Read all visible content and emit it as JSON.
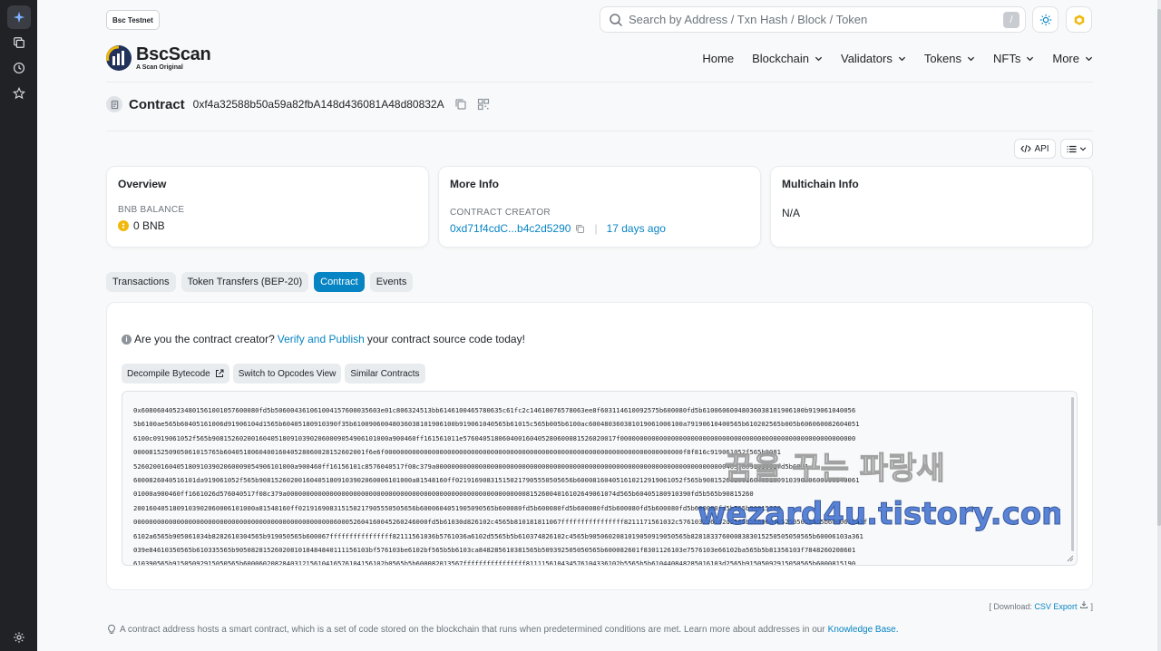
{
  "network_badge": "Bsc Testnet",
  "search": {
    "placeholder": "Search by Address / Txn Hash / Block / Token",
    "shortcut": "/"
  },
  "logo": {
    "brand": "BscScan",
    "tagline": "A Scan Original"
  },
  "nav": [
    "Home",
    "Blockchain",
    "Validators",
    "Tokens",
    "NFTs",
    "More"
  ],
  "contract": {
    "label": "Contract",
    "address": "0xf4a32588b50a59a82fbA148d436081A48d80832A"
  },
  "toolbar": {
    "api_label": "API"
  },
  "overview": {
    "title": "Overview",
    "balance_label": "BNB BALANCE",
    "balance_value": "0 BNB"
  },
  "more_info": {
    "title": "More Info",
    "creator_label": "CONTRACT CREATOR",
    "creator_address": "0xd71f4cdC...b4c2d5290",
    "creator_age": "17 days ago"
  },
  "multichain": {
    "title": "Multichain Info",
    "value": "N/A"
  },
  "tabs": [
    "Transactions",
    "Token Transfers (BEP-20)",
    "Contract",
    "Events"
  ],
  "notice": {
    "prefix": "Are you the contract creator?",
    "link": "Verify and Publish",
    "suffix": "your contract source code today!"
  },
  "actions": [
    "Decompile Bytecode",
    "Switch to Opcodes View",
    "Similar Contracts"
  ],
  "bytecode": "0x608060405234801561001057600080fd5b50600436106100415760003560e01c806324513bb6146100465780635c61fc2c14610076578063ee8f603114610092575b600080fd5b610060600480360381019061005b9190610400565b6100ae565b60405161006d91906104d1565b60405180910390f35b61009060048036038101906100b91906104005656b61015c565b005b6100ac6004803603810190610...",
  "bytecode_lines": [
    "0x608060405234801561001057600080fd5b506004361061004157600035603e01c806324513bb6146100465780635c61fc2c14610076578063ee8f603114610092575b600080fd5b61006060048036038101906100b919061040056",
    "5b6100ae565b60405161006d91906104d1565b60405180910390f35b61009060048036038101906100b919061040565b61015c565b005b6100ac600480360381019061006100a79190610400565b610202565b005b606060082604051",
    "6100c0919061052f565b908152602001604051809103902060009054906101000a900460ff161561011e576040518060400160405280600081526020017f000000000000000000000000000000000000000000000000000000000000",
    "0000815250905061015765b604051806040016040528060028152602001f6e6f0000000000000000000000000000000000000000000000000000000000000000000000000000f8f816c919061052f565b9081",
    "52602001604051809103902060009054906101000a900460ff16156101c8576040517f08c379a000000000000000000000000000000000000000000000000000000000000000000000000004051809103902fd5b6001",
    "600082604051610 1da919061052f565b908152602001604051809103902060006101000a81548160ff021916908315150217905550505656b600081604051610212919061052f565b908152602001604051809103902060009054906 1",
    "01000a900460ff1661026d576040517f08c379a000000000000000000000000000000000000000000000000000000000000081526004016102649061074d565b60405180910390fd5b565b90815260",
    "200160405180910390206000610100 0a81548160ff021916908315150217905550505656b6000604051905090565b600080fd5b600080fd5b600080fd5b600080fd5b600080fd5b600080fd5b565b90815260",
    "0000000000000000000000000000000000000000000000000006000526041600452602460 00fd5b61030d826102c4565b810181811067ffffffffffffffff8211171561032c5761032b6102d5565b5b80604052505050565b600061033f",
    "6102a6565b905061034b8282610304565b919050565b600067ffffffffffffffff82111561036b5761036a6102d5565b5b610374826102c4565b9050602081019050919050565b8281833760008383015250505050565b60006103a361",
    "039e84610350565b610335565b905082815260208101848484011115610 3bf5761 03be6102bf565b5b6103ca848285610381565b509392505050565b600082601f8301126103e757610 3e66102ba565b5b8135610 3f78482602086 01",
    "610390565b91505092915050565b6000602082840312156104165761 0415610 2b0565b5b600082013567ffffffffffffffff811115610434576104336102b5565b5b61044084828501610 3d2565b91505092915050565b600081519 0"
  ],
  "csv": {
    "prefix": "[ Download:",
    "link": "CSV Export",
    "suffix": "]"
  },
  "footnote": {
    "text": "A contract address hosts a smart contract, which is a set of code stored on the blockchain that runs when predetermined conditions are met. Learn more about addresses in our",
    "link": "Knowledge Base."
  },
  "watermark": {
    "line1": "꿈을 꾸는 파랑새",
    "line2": "wezard4u.tistory.com"
  },
  "colors": {
    "accent": "#0784c3",
    "rail": "#202226",
    "bnb": "#f0b90b"
  }
}
